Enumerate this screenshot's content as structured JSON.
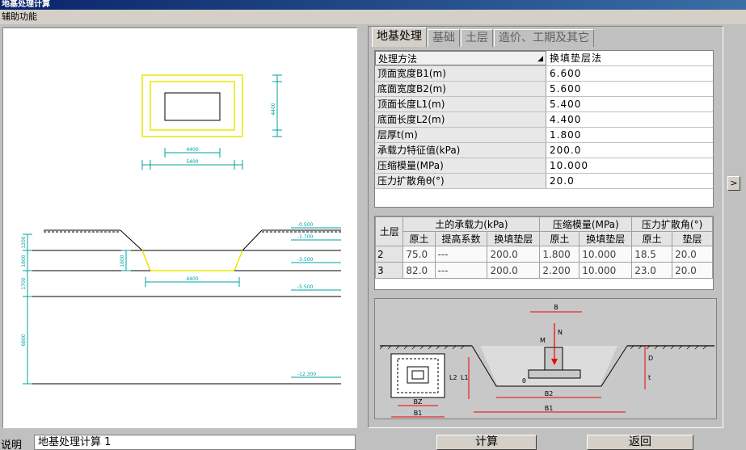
{
  "window": {
    "title": "地基处理计算"
  },
  "menu": {
    "item": "辅助功能"
  },
  "tabs": [
    "地基处理",
    "基础",
    "土层",
    "造价、工期及其它"
  ],
  "params": [
    {
      "name": "处理方法",
      "value": "换填垫层法"
    },
    {
      "name": "顶面宽度B1(m)",
      "value": "6.600"
    },
    {
      "name": "底面宽度B2(m)",
      "value": "5.600"
    },
    {
      "name": "顶面长度L1(m)",
      "value": "5.400"
    },
    {
      "name": "底面长度L2(m)",
      "value": "4.400"
    },
    {
      "name": "层厚t(m)",
      "value": "1.800"
    },
    {
      "name": "承载力特征值(kPa)",
      "value": "200.0"
    },
    {
      "name": "压缩模量(MPa)",
      "value": "10.000"
    },
    {
      "name": "压力扩散角θ(°)",
      "value": "20.0"
    }
  ],
  "side_button": ">",
  "soil": {
    "h_layer": "土层",
    "h_bearing": "土的承载力(kPa)",
    "h_modulus": "压缩模量(MPa)",
    "h_angle": "压力扩散角(°)",
    "sub": [
      "原土",
      "提高系数",
      "换填垫层",
      "原土",
      "换填垫层",
      "原土",
      "垫层"
    ],
    "rows": [
      [
        "2",
        "75.0",
        "---",
        "200.0",
        "1.800",
        "10.000",
        "18.5",
        "20.0"
      ],
      [
        "3",
        "82.0",
        "---",
        "200.0",
        "2.200",
        "10.000",
        "23.0",
        "20.0"
      ]
    ]
  },
  "diagram": {
    "labels": {
      "B": "B",
      "M": "M",
      "N": "N",
      "D": "D",
      "t": "t",
      "L2": "L2",
      "L1": "L1",
      "theta": "θ",
      "BZ": "BZ",
      "B1_small": "B1",
      "B2": "B2",
      "B1": "B1"
    }
  },
  "drawing": {
    "plan_w_inner": "4400",
    "plan_w_outer": "5400",
    "plan_h": "4400",
    "sect_w": "4400",
    "elev_1": "-0.500",
    "elev_2": "-1.700",
    "elev_3": "-3.500",
    "elev_4": "-5.500",
    "elev_5": "-12.300",
    "dim_1": "1200",
    "dim_2": "1800",
    "dim_3": "1700",
    "dim_4": "6800"
  },
  "status": {
    "label": "说明",
    "text": "地基处理计算 1",
    "calc": "计算",
    "back": "返回"
  }
}
